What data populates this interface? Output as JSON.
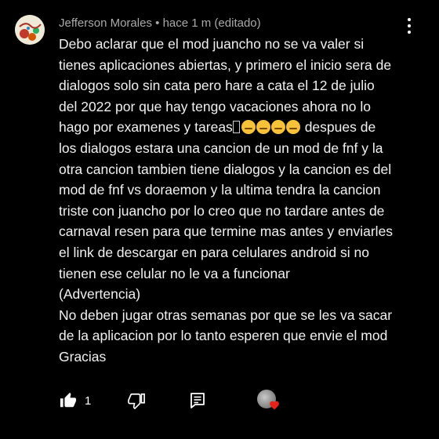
{
  "comment": {
    "author": "Jefferson Morales",
    "separator": "•",
    "time": "hace 1 m (editado)",
    "lines": [
      "Debo aclarar que el mod juancho no se va valer si",
      "tienes aplicaciones abiertas, y primero el inicio sera de",
      "dialogos solo sin cata pero hare a cata el 12 de julio",
      "del 2022 por que hay tengo vacaciones ahora no lo",
      "hago por examenes y tareas",
      "despues de",
      "los dialogos estara una cancion de un mod de fnf y la",
      "otra cancion tambien tiene dialogos y la cancion es del",
      "mod de fnf  vs doraemon y la ultima tendra la cancion",
      "triste con juancho por lo creo que no tardare antes de",
      "carnaval resen para que termine mas antes y enviarles",
      "el link de descargar en para celulares android si no",
      "tienen ese celular no le va a funcionar",
      "(Advertencia)",
      "No deben jugar otras semanas por que se les va sacar",
      "de la aplicacion por lo tanto esperen que envie el mod",
      "Gracias"
    ]
  },
  "actions": {
    "like_count": "1"
  },
  "icons": {
    "more": "more-vert-icon",
    "like": "thumb-up-icon",
    "dislike": "thumb-down-icon",
    "reply": "reply-comment-icon",
    "creator_heart": "creator-heart-icon"
  },
  "colors": {
    "background": "#000000",
    "meta_text": "#aaaaaa",
    "body_text": "#f1f1f1",
    "heart": "#e62117"
  }
}
